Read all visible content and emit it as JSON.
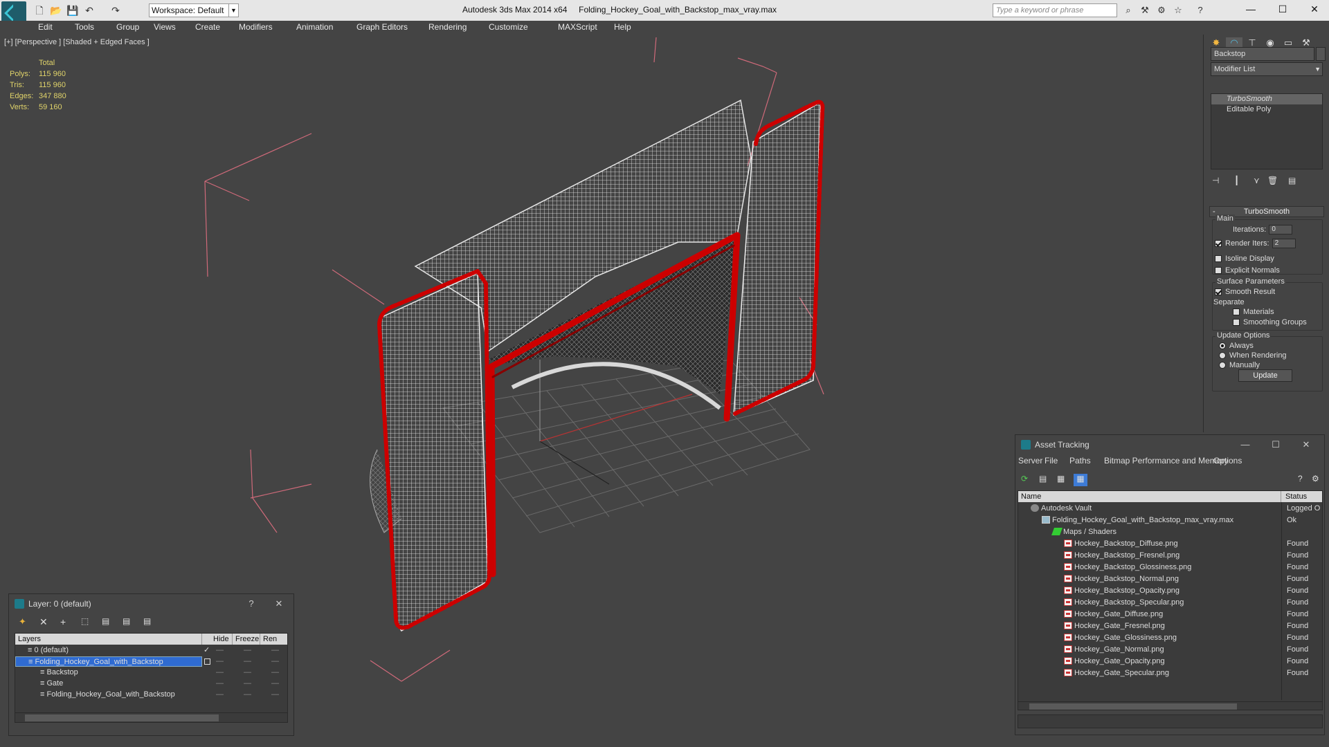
{
  "app": {
    "title": "Autodesk 3ds Max  2014 x64",
    "filename": "Folding_Hockey_Goal_with_Backstop_max_vray.max",
    "workspace": "Workspace: Default",
    "search_placeholder": "Type a keyword or phrase"
  },
  "menu": [
    "Edit",
    "Tools",
    "Group",
    "Views",
    "Create",
    "Modifiers",
    "Animation",
    "Graph Editors",
    "Rendering",
    "Customize",
    "MAXScript",
    "Help"
  ],
  "viewport": {
    "label": "[+] [Perspective ] [Shaded + Edged Faces ]",
    "stats": {
      "header": "Total",
      "polys_label": "Polys:",
      "polys": "115 960",
      "tris_label": "Tris:",
      "tris": "115 960",
      "edges_label": "Edges:",
      "edges": "347 880",
      "verts_label": "Verts:",
      "verts": "59 160"
    },
    "colors": {
      "background": "#444444",
      "frame": "#cc0000",
      "net": "#f2f2f2",
      "bbox": "#d06a7a",
      "grid": "#6a6a6a"
    }
  },
  "command_panel": {
    "object_name": "Backstop",
    "modifier_list": "Modifier List",
    "stack": [
      "TurboSmooth",
      "Editable Poly"
    ],
    "rollout": "TurboSmooth",
    "main_group": "Main",
    "iterations_label": "Iterations:",
    "iterations": "0",
    "render_iters_label": "Render Iters:",
    "render_iters": "2",
    "isoline": "Isoline Display",
    "explicit_normals": "Explicit Normals",
    "surface_group": "Surface Parameters",
    "smooth_result": "Smooth Result",
    "separate": "Separate",
    "materials": "Materials",
    "smoothing_groups": "Smoothing Groups",
    "update_group": "Update Options",
    "always": "Always",
    "when_rendering": "When Rendering",
    "manually": "Manually",
    "update_button": "Update"
  },
  "layer_panel": {
    "title": "Layer: 0 (default)",
    "help": "?",
    "columns": [
      "Layers",
      "Hide",
      "Freeze",
      "Ren"
    ],
    "rows": [
      {
        "name": "0 (default)",
        "indent": 1
      },
      {
        "name": "Folding_Hockey_Goal_with_Backstop",
        "indent": 1,
        "selected": true
      },
      {
        "name": "Backstop",
        "indent": 2
      },
      {
        "name": "Gate",
        "indent": 2
      },
      {
        "name": "Folding_Hockey_Goal_with_Backstop",
        "indent": 2
      }
    ]
  },
  "asset_panel": {
    "title": "Asset Tracking",
    "menu": [
      "Server",
      "File",
      "Paths",
      "Bitmap Performance and Memory",
      "Options"
    ],
    "columns": [
      "Name",
      "Status"
    ],
    "rows": [
      {
        "name": "Autodesk Vault",
        "status": "Logged O",
        "level": 0
      },
      {
        "name": "Folding_Hockey_Goal_with_Backstop_max_vray.max",
        "status": "Ok",
        "level": 1
      },
      {
        "name": "Maps / Shaders",
        "status": "",
        "level": 2
      },
      {
        "name": "Hockey_Backstop_Diffuse.png",
        "status": "Found",
        "level": 3
      },
      {
        "name": "Hockey_Backstop_Fresnel.png",
        "status": "Found",
        "level": 3
      },
      {
        "name": "Hockey_Backstop_Glossiness.png",
        "status": "Found",
        "level": 3
      },
      {
        "name": "Hockey_Backstop_Normal.png",
        "status": "Found",
        "level": 3
      },
      {
        "name": "Hockey_Backstop_Opacity.png",
        "status": "Found",
        "level": 3
      },
      {
        "name": "Hockey_Backstop_Specular.png",
        "status": "Found",
        "level": 3
      },
      {
        "name": "Hockey_Gate_Diffuse.png",
        "status": "Found",
        "level": 3
      },
      {
        "name": "Hockey_Gate_Fresnel.png",
        "status": "Found",
        "level": 3
      },
      {
        "name": "Hockey_Gate_Glossiness.png",
        "status": "Found",
        "level": 3
      },
      {
        "name": "Hockey_Gate_Normal.png",
        "status": "Found",
        "level": 3
      },
      {
        "name": "Hockey_Gate_Opacity.png",
        "status": "Found",
        "level": 3
      },
      {
        "name": "Hockey_Gate_Specular.png",
        "status": "Found",
        "level": 3
      }
    ]
  }
}
